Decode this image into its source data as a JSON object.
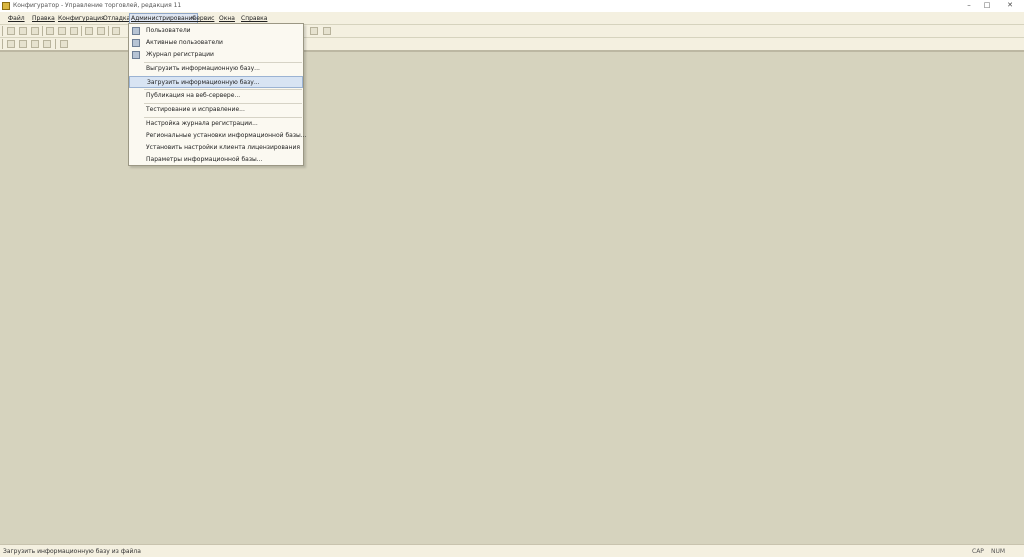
{
  "window": {
    "title": "Конфигуратор - Управление торговлей, редакция 11",
    "minimize": "–",
    "maximize": "□",
    "close": "✕"
  },
  "menubar": {
    "items": [
      "Файл",
      "Правка",
      "Конфигурация",
      "Отладка",
      "Администрирование",
      "Сервис",
      "Окна",
      "Справка"
    ],
    "active": "Администрирование"
  },
  "admin_menu": {
    "items": [
      {
        "label": "Пользователи",
        "icon": "users-icon"
      },
      {
        "label": "Активные пользователи",
        "icon": "active-users-icon"
      },
      {
        "label": "Журнал регистрации",
        "icon": "event-log-icon"
      },
      {
        "label": "Выгрузить информационную базу..."
      },
      {
        "label": "Загрузить информационную базу...",
        "selected": true
      },
      {
        "label": "Публикация на веб-сервере..."
      },
      {
        "label": "Тестирование и исправление..."
      },
      {
        "label": "Настройка журнала регистрации..."
      },
      {
        "label": "Региональные установки информационной базы..."
      },
      {
        "label": "Установить настройки клиента лицензирования"
      },
      {
        "label": "Параметры информационной базы..."
      }
    ]
  },
  "statusbar": {
    "text": "Загрузить информационную базу из файла",
    "cap": "CAP",
    "num": "NUM"
  }
}
